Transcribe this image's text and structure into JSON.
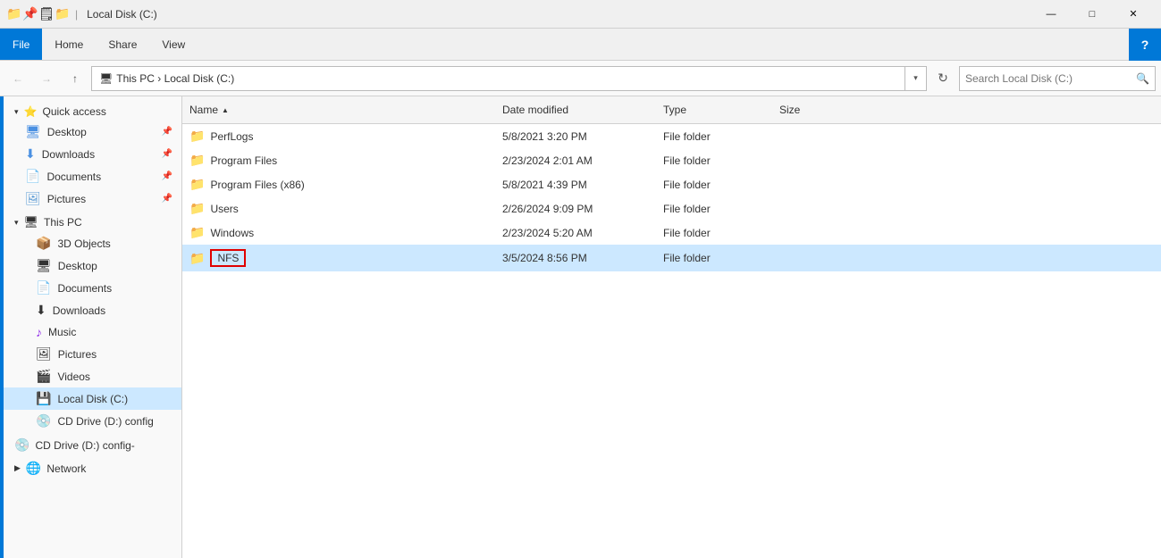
{
  "titleBar": {
    "icon": "🗁",
    "quickAccessIcons": [
      "📌",
      "🗒",
      "📁"
    ],
    "title": "Local Disk (C:)",
    "controls": {
      "minimize": "—",
      "maximize": "□",
      "close": "✕"
    }
  },
  "menuBar": {
    "tabs": [
      "File",
      "Home",
      "Share",
      "View"
    ],
    "activeTab": "File",
    "helpIcon": "?"
  },
  "addressBar": {
    "backBtn": "←",
    "forwardBtn": "→",
    "upBtn": "↑",
    "path": "This PC  ›  Local Disk (C:)",
    "pathDropdown": "▾",
    "refreshBtn": "↻",
    "searchPlaceholder": "Search Local Disk (C:)",
    "searchIcon": "🔍"
  },
  "sidebar": {
    "sections": [
      {
        "name": "quick-access",
        "label": "Quick access",
        "icon": "⭐",
        "items": [
          {
            "id": "desktop",
            "label": "Desktop",
            "icon": "🖥",
            "pinned": true
          },
          {
            "id": "downloads",
            "label": "Downloads",
            "icon": "⬇",
            "pinned": true
          },
          {
            "id": "documents",
            "label": "Documents",
            "icon": "📄",
            "pinned": true
          },
          {
            "id": "pictures",
            "label": "Pictures",
            "icon": "🖼",
            "pinned": true
          }
        ]
      },
      {
        "name": "this-pc",
        "label": "This PC",
        "icon": "💻",
        "items": [
          {
            "id": "3d-objects",
            "label": "3D Objects",
            "icon": "📦"
          },
          {
            "id": "desktop2",
            "label": "Desktop",
            "icon": "🖥"
          },
          {
            "id": "documents2",
            "label": "Documents",
            "icon": "📄"
          },
          {
            "id": "downloads2",
            "label": "Downloads",
            "icon": "⬇"
          },
          {
            "id": "music",
            "label": "Music",
            "icon": "♪"
          },
          {
            "id": "pictures2",
            "label": "Pictures",
            "icon": "🖼"
          },
          {
            "id": "videos",
            "label": "Videos",
            "icon": "🎬"
          },
          {
            "id": "local-disk",
            "label": "Local Disk (C:)",
            "icon": "💾",
            "selected": true
          },
          {
            "id": "cd-drive1",
            "label": "CD Drive (D:) config",
            "icon": "💿"
          }
        ]
      },
      {
        "name": "cd-drive-section",
        "label": "CD Drive (D:) config-",
        "icon": "💿"
      },
      {
        "name": "network-section",
        "label": "Network",
        "icon": "🌐"
      }
    ]
  },
  "content": {
    "columns": [
      {
        "id": "name",
        "label": "Name",
        "sortArrow": "▲"
      },
      {
        "id": "date-modified",
        "label": "Date modified"
      },
      {
        "id": "type",
        "label": "Type"
      },
      {
        "id": "size",
        "label": "Size"
      }
    ],
    "files": [
      {
        "id": "perflogs",
        "name": "PerfLogs",
        "dateModified": "5/8/2021 3:20 PM",
        "type": "File folder",
        "size": ""
      },
      {
        "id": "program-files",
        "name": "Program Files",
        "dateModified": "2/23/2024 2:01 AM",
        "type": "File folder",
        "size": ""
      },
      {
        "id": "program-files-x86",
        "name": "Program Files (x86)",
        "dateModified": "5/8/2021 4:39 PM",
        "type": "File folder",
        "size": ""
      },
      {
        "id": "users",
        "name": "Users",
        "dateModified": "2/26/2024 9:09 PM",
        "type": "File folder",
        "size": ""
      },
      {
        "id": "windows",
        "name": "Windows",
        "dateModified": "2/23/2024 5:20 AM",
        "type": "File folder",
        "size": ""
      },
      {
        "id": "nfs",
        "name": "NFS",
        "dateModified": "3/5/2024 8:56 PM",
        "type": "File folder",
        "size": "",
        "selected": true,
        "highlighted": true
      }
    ]
  }
}
